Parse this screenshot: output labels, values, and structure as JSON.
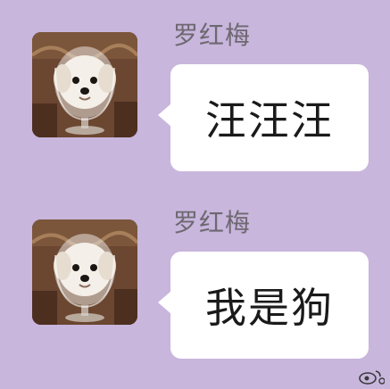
{
  "messages": [
    {
      "sender": "罗红梅",
      "text": "汪汪汪",
      "avatar_icon": "dog-in-glass-avatar"
    },
    {
      "sender": "罗红梅",
      "text": "我是狗",
      "avatar_icon": "dog-in-glass-avatar"
    }
  ],
  "colors": {
    "background": "#c8b6dd",
    "bubble": "#ffffff",
    "sender_text": "#6d6870",
    "message_text": "#1a1a1a"
  },
  "watermark_icon": "weibo-icon"
}
